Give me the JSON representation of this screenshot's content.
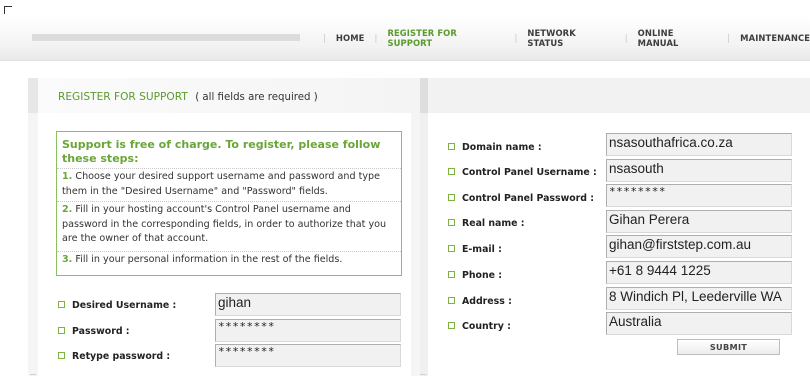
{
  "nav": {
    "items": [
      {
        "label": "HOME",
        "active": false
      },
      {
        "label": "REGISTER FOR SUPPORT",
        "active": true
      },
      {
        "label": "NETWORK STATUS",
        "active": false
      },
      {
        "label": "ONLINE MANUAL",
        "active": false
      },
      {
        "label": "MAINTENANCE",
        "active": false
      }
    ]
  },
  "page": {
    "title": "REGISTER FOR SUPPORT",
    "subtitle": "( all fields are required )"
  },
  "info": {
    "heading": "Support is free of charge. To register, please follow these steps:",
    "steps": [
      {
        "num": "1.",
        "text": "Choose your desired support username and password and type them in the \"Desired Username\" and \"Password\" fields."
      },
      {
        "num": "2.",
        "text": "Fill in your hosting account's Control Panel username and password in the corresponding fields, in order to authorize that you are the owner of that account."
      },
      {
        "num": "3.",
        "text": "Fill in your personal information in the rest of the fields."
      }
    ]
  },
  "left_form": {
    "desired_username": {
      "label": "Desired Username :",
      "value": "gihan"
    },
    "password": {
      "label": "Password :",
      "value": "********"
    },
    "retype_password": {
      "label": "Retype password :",
      "value": "********"
    }
  },
  "right_form": {
    "domain_name": {
      "label": "Domain name :",
      "value": "nsasouthafrica.co.za"
    },
    "cp_username": {
      "label": "Control Panel Username :",
      "value": "nsasouth"
    },
    "cp_password": {
      "label": "Control Panel Password :",
      "value": "********"
    },
    "real_name": {
      "label": "Real name :",
      "value": "Gihan Perera"
    },
    "email": {
      "label": "E-mail :",
      "value": "gihan@firststep.com.au"
    },
    "phone": {
      "label": "Phone :",
      "value": "+61 8 9444 1225"
    },
    "address": {
      "label": "Address :",
      "value": "8 Windich Pl, Leederville WA"
    },
    "country": {
      "label": "Country :",
      "value": "Australia"
    }
  },
  "submit_label": "SUBMIT",
  "colors": {
    "accent": "#5b9a2e",
    "box_border": "#8cc05e",
    "field_bg": "#f1f1f1"
  }
}
